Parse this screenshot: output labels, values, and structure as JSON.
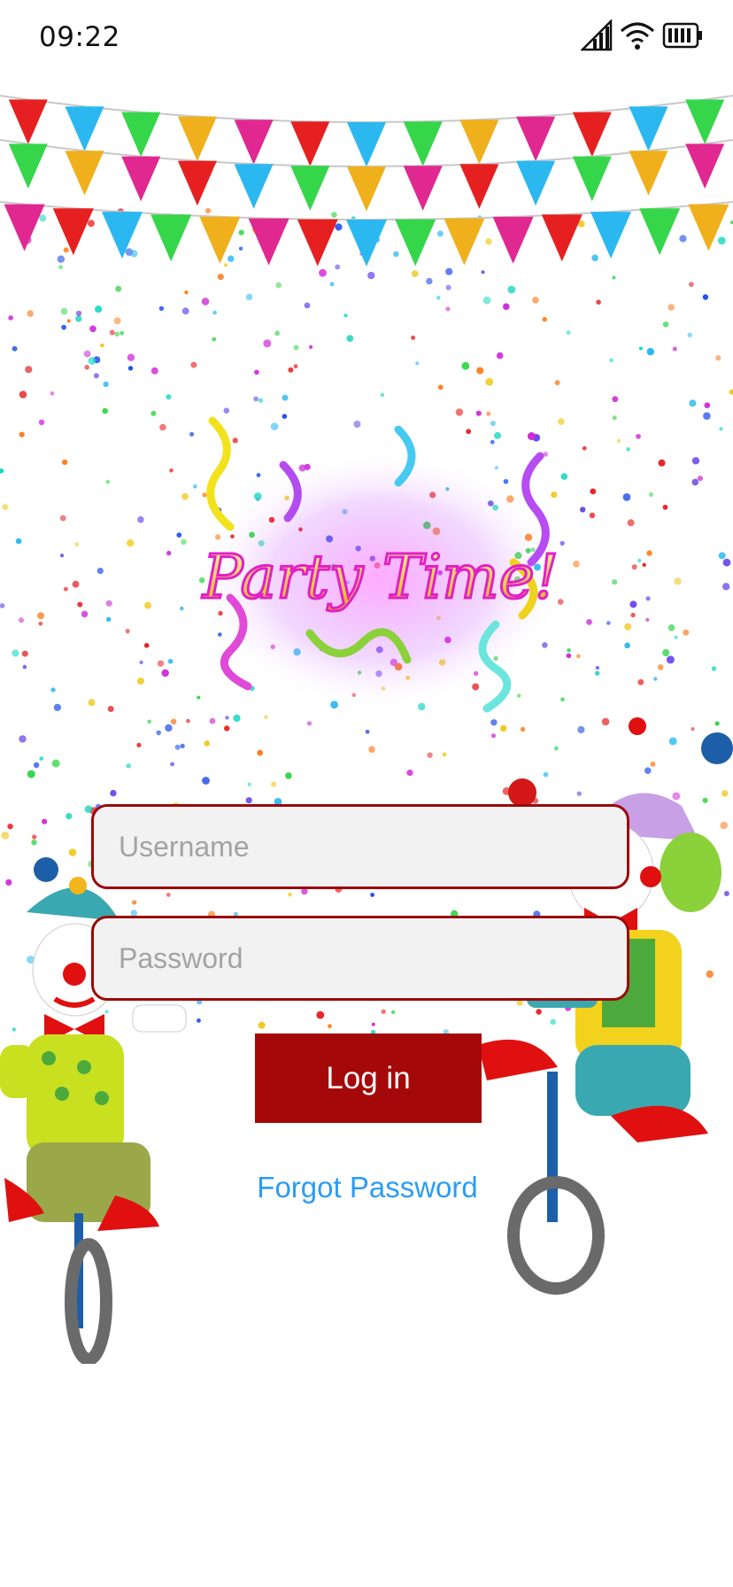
{
  "status_bar": {
    "time": "09:22",
    "icons": [
      "signal-icon",
      "wifi-icon",
      "battery-icon"
    ]
  },
  "hero": {
    "logo_text": "Party Time!"
  },
  "login_form": {
    "username_placeholder": "Username",
    "password_placeholder": "Password",
    "login_label": "Log in",
    "forgot_label": "Forgot Password"
  },
  "colors": {
    "accent_red": "#a50808",
    "field_border": "#9b0a0a",
    "field_bg": "#f2f2f3",
    "link_blue": "#2b9cf4"
  }
}
